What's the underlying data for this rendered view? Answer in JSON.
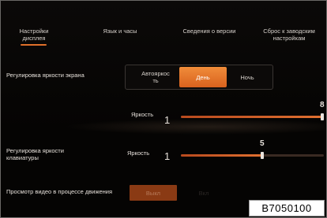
{
  "tabs": [
    {
      "label": "Настройки\nдисплея",
      "active": true
    },
    {
      "label": "Язык и часы"
    },
    {
      "label": "Сведения о версии"
    },
    {
      "label": "Сброс к заводским\nнастройкам"
    }
  ],
  "screen_brightness": {
    "label": "Регулировка яркости экрана",
    "modes": [
      "Автояркос\nть",
      "День",
      "Ночь"
    ],
    "selected": "День"
  },
  "brightness_slider": {
    "label": "Яркость",
    "min_label": "1",
    "value": "8",
    "fraction": 1.0
  },
  "keypad_brightness": {
    "label": "Регулировка яркости\nклавиатуры",
    "slider_label": "Яркость",
    "min_label": "1",
    "value": "5",
    "fraction": 0.57
  },
  "video_while_driving": {
    "label": "Просмотр видео в процессе движения",
    "off_label": "Выкл",
    "on_label": "Вкл"
  },
  "image_code": "B7050100",
  "colors": {
    "accent": "#e0702a",
    "background": "#050403"
  }
}
